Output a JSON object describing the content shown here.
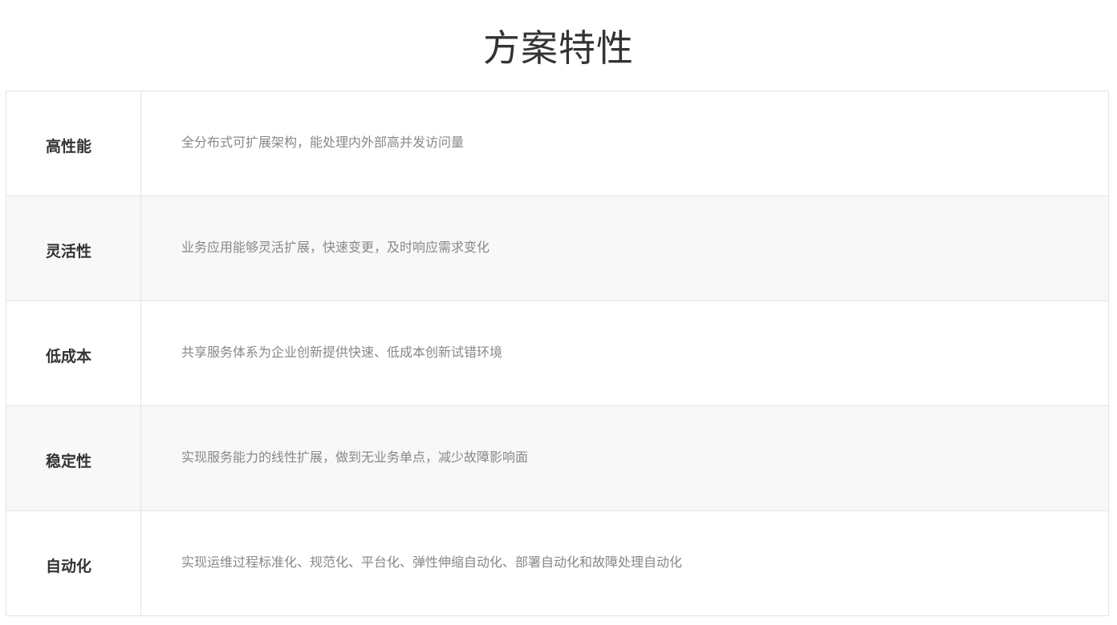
{
  "page": {
    "title": "方案特性"
  },
  "features": [
    {
      "name": "高性能",
      "description": "全分布式可扩展架构，能处理内外部高并发访问量"
    },
    {
      "name": "灵活性",
      "description": "业务应用能够灵活扩展，快速变更，及时响应需求变化"
    },
    {
      "name": "低成本",
      "description": "共享服务体系为企业创新提供快速、低成本创新试错环境"
    },
    {
      "name": "稳定性",
      "description": "实现服务能力的线性扩展，做到无业务单点，减少故障影响面"
    },
    {
      "name": "自动化",
      "description": "实现运维过程标准化、规范化、平台化、弹性伸缩自动化、部署自动化和故障处理自动化"
    }
  ],
  "colors": {
    "title": "#333333",
    "feature_name": "#333333",
    "description": "#888888",
    "border": "#e4e4e4",
    "shaded_row": "#f8f8f8"
  }
}
